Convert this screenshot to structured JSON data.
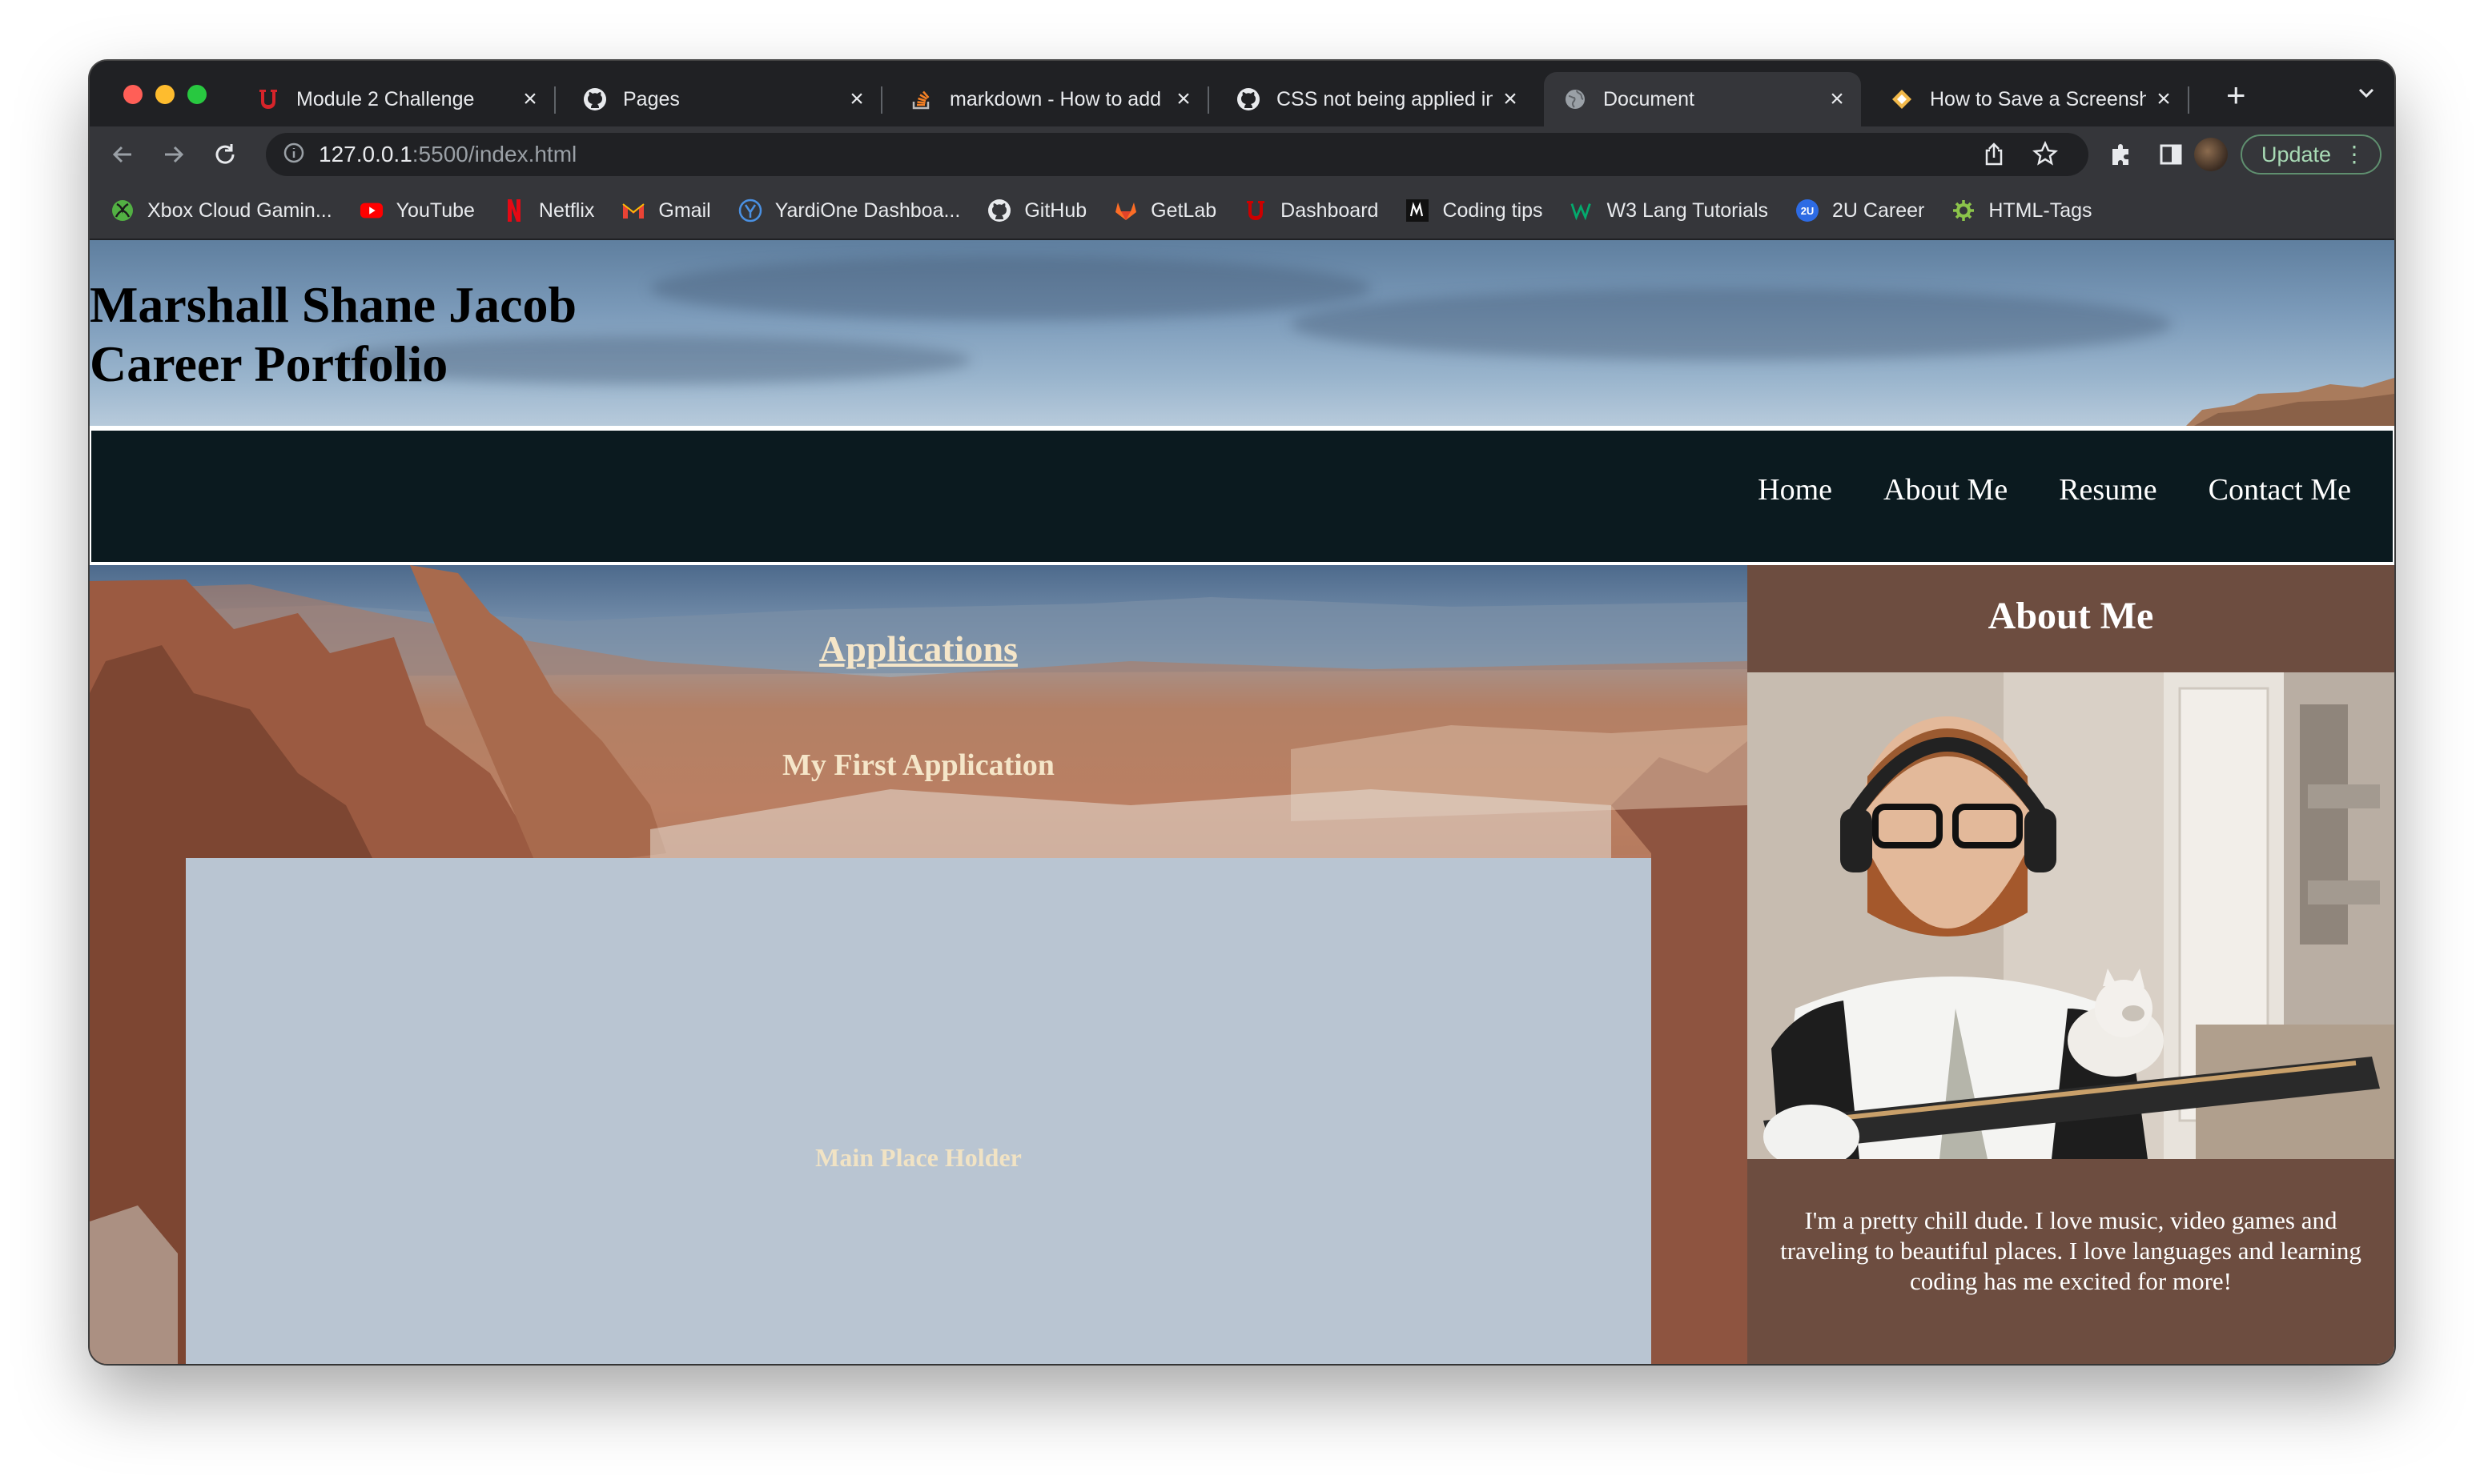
{
  "browser": {
    "tabs": [
      {
        "title": "Module 2 Challenge",
        "favicon": "university-u-icon",
        "active": false
      },
      {
        "title": "Pages",
        "favicon": "github-icon",
        "active": false
      },
      {
        "title": "markdown - How to add",
        "favicon": "stackoverflow-icon",
        "active": false
      },
      {
        "title": "CSS not being applied in",
        "favicon": "github-icon",
        "active": false
      },
      {
        "title": "Document",
        "favicon": "globe-icon",
        "active": true
      },
      {
        "title": "How to Save a Screensh",
        "favicon": "diamond-icon",
        "active": false
      }
    ],
    "address": {
      "host": "127.0.0.1",
      "path": ":5500/index.html"
    },
    "update_label": "Update",
    "bookmarks": [
      {
        "label": "Xbox Cloud Gamin...",
        "icon": "xbox-icon",
        "color": "#52b043"
      },
      {
        "label": "YouTube",
        "icon": "youtube-icon",
        "color": "#ff0000"
      },
      {
        "label": "Netflix",
        "icon": "netflix-icon",
        "color": "#e50914"
      },
      {
        "label": "Gmail",
        "icon": "gmail-icon",
        "color": "#ea4335"
      },
      {
        "label": "YardiOne Dashboa...",
        "icon": "yardi-icon",
        "color": "#4a90e2"
      },
      {
        "label": "GitHub",
        "icon": "github-icon",
        "color": "#ffffff"
      },
      {
        "label": "GetLab",
        "icon": "gitlab-icon",
        "color": "#fc6d26"
      },
      {
        "label": "Dashboard",
        "icon": "university-u-icon",
        "color": "#cc0000"
      },
      {
        "label": "Coding tips",
        "icon": "medium-icon",
        "color": "#ffffff"
      },
      {
        "label": "W3 Lang Tutorials",
        "icon": "w3-icon",
        "color": "#04aa6d"
      },
      {
        "label": "2U Career",
        "icon": "2u-icon",
        "color": "#2d6be4"
      },
      {
        "label": "HTML-Tags",
        "icon": "gear-icon",
        "color": "#8bc34a"
      }
    ]
  },
  "site": {
    "title_line1": "Marshall Shane Jacob",
    "title_line2": "Career Portfolio",
    "nav": [
      "Home",
      "About Me",
      "Resume",
      "Contact Me"
    ],
    "applications_heading": "Applications",
    "first_application": "My First Application",
    "placeholder": "Main Place Holder",
    "about_heading": "About Me",
    "about_text": "I'm a pretty chill dude. I love music, video games and traveling to beautiful places. I love languages and learning coding has me excited for more!"
  },
  "colors": {
    "nav_bg": "#0b1a1f",
    "aside_bg": "#6d4d40",
    "placeholder_bg": "#b9c5d2",
    "heading_cream": "#f5e6c9"
  }
}
